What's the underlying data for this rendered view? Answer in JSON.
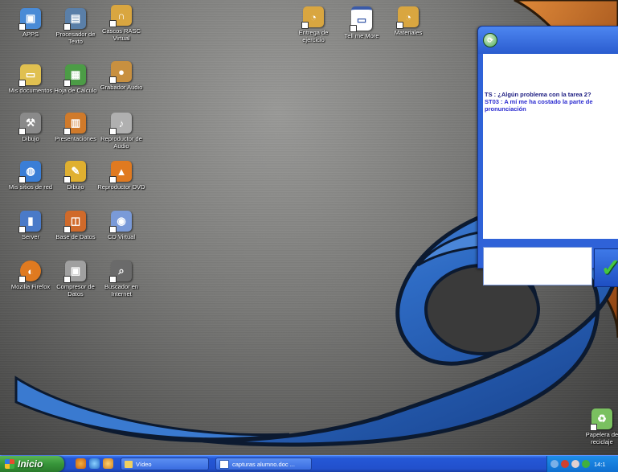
{
  "desktop": {
    "icons": [
      {
        "id": "apps",
        "label": "APPS",
        "icon": "monitor-icon",
        "color": "#4a8bd6"
      },
      {
        "id": "word",
        "label": "Procesador de Texto",
        "icon": "document-computer-icon",
        "color": "#5a7fa8"
      },
      {
        "id": "cascos",
        "label": "Cascos RASC Virtual",
        "icon": "headphones-icon",
        "color": "#d9a640"
      },
      {
        "id": "documents",
        "label": "Mis documentos",
        "icon": "folder-icon",
        "color": "#e0c050"
      },
      {
        "id": "spreadsheet",
        "label": "Hoja de Cálculo",
        "icon": "spreadsheet-icon",
        "color": "#4c9c46"
      },
      {
        "id": "audio-rec",
        "label": "Grabador Audio",
        "icon": "audio-recorder-icon",
        "color": "#c89040"
      },
      {
        "id": "tools",
        "label": "Dibujo",
        "icon": "wrench-icon",
        "color": "#8a8a8a"
      },
      {
        "id": "presentations",
        "label": "Presentaciones",
        "icon": "presentation-icon",
        "color": "#d07a2a"
      },
      {
        "id": "audio-player",
        "label": "Reproductor de Audio",
        "icon": "speaker-icon",
        "color": "#b0b0b0"
      },
      {
        "id": "network",
        "label": "Mis sitios de red",
        "icon": "network-globe-icon",
        "color": "#3a7ed6"
      },
      {
        "id": "drawing",
        "label": "Dibujo",
        "icon": "drawing-icon",
        "color": "#e0b030"
      },
      {
        "id": "video-player",
        "label": "Reproductor DVD",
        "icon": "vlc-cone-icon",
        "color": "#e07a20"
      },
      {
        "id": "server",
        "label": "Server",
        "icon": "server-icon",
        "color": "#4a7ac8"
      },
      {
        "id": "database",
        "label": "Base de Datos",
        "icon": "database-icon",
        "color": "#d06a2a"
      },
      {
        "id": "cd-virtual",
        "label": "CD Virtual",
        "icon": "cd-icon",
        "color": "#7a9ad8"
      },
      {
        "id": "firefox",
        "label": "Mozilla Firefox",
        "icon": "firefox-icon",
        "color": "#e07a20"
      },
      {
        "id": "compressor",
        "label": "Compresor de Datos",
        "icon": "compressor-icon",
        "color": "#a0a0a0"
      },
      {
        "id": "search",
        "label": "Buscador en Internet",
        "icon": "search-icon",
        "color": "#6a6a6a"
      },
      {
        "id": "entrega",
        "label": "Entrega de ejercicio",
        "icon": "submit-icon",
        "color": "#d9a640"
      },
      {
        "id": "tellmemore",
        "label": "Tell me More",
        "icon": "window-icon",
        "color": "#3a5aa8"
      },
      {
        "id": "materiales",
        "label": "Materiales",
        "icon": "materials-icon",
        "color": "#d9a640"
      },
      {
        "id": "recycle",
        "label": "Papelera de reciclaje",
        "icon": "recycle-bin-icon",
        "color": "#7ac060"
      }
    ]
  },
  "chat": {
    "messages": [
      {
        "text": "TS : ¿Algún problema con la tarea 2?",
        "color": "#1a1a80"
      },
      {
        "text": "ST03 : A mí me ha costado la parte de pronunciación",
        "color": "#2a2ad0"
      }
    ],
    "send_symbol": "✓",
    "input_value": ""
  },
  "taskbar": {
    "start_label": "Inicio",
    "tasks": [
      {
        "label": "Vídeo",
        "icon": "folder-icon"
      },
      {
        "label": "capturas alumno.doc ...",
        "icon": "word-document-icon"
      }
    ],
    "clock": "14:1"
  }
}
